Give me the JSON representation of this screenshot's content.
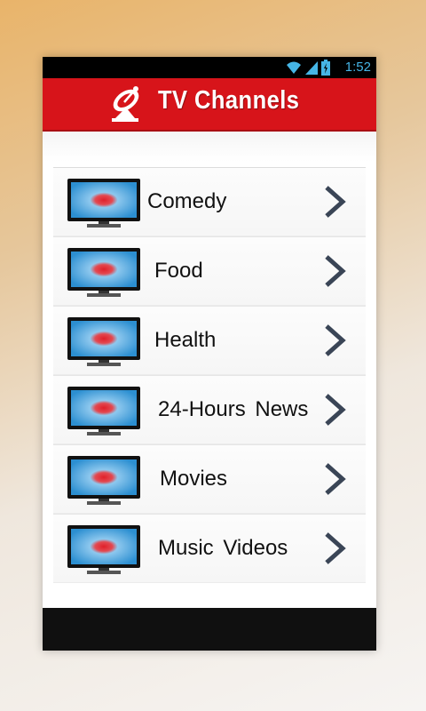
{
  "status_bar": {
    "time": "1:52",
    "icons": [
      "wifi-icon",
      "signal-icon",
      "battery-icon"
    ],
    "color": "#46b5e6"
  },
  "app_bar": {
    "title": "TV Channels",
    "icon": "satellite-dish-icon",
    "color": "#d7141a"
  },
  "channels": [
    {
      "label": "Comedy"
    },
    {
      "label": "Food"
    },
    {
      "label": "Health"
    },
    {
      "label": "24-Hours News"
    },
    {
      "label": "Movies"
    },
    {
      "label": "Music Videos"
    }
  ],
  "colors": {
    "accent": "#d7141a",
    "tv_screen": "#2c8fd1",
    "chevron": "#3a4556"
  }
}
